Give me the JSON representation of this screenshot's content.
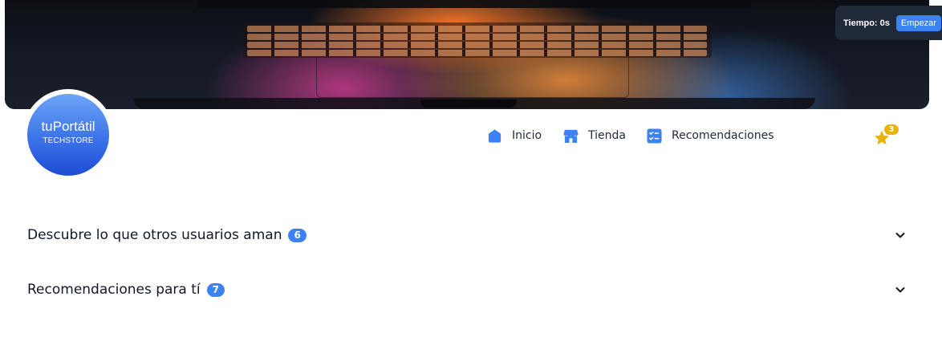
{
  "timer": {
    "label": "Tiempo: 0s",
    "start_label": "Empezar"
  },
  "brand": {
    "name": "tuPortátil",
    "tagline": "TECHSTORE"
  },
  "nav": {
    "items": [
      {
        "label": "Inicio",
        "icon": "home-icon"
      },
      {
        "label": "Tienda",
        "icon": "store-icon"
      },
      {
        "label": "Recomendaciones",
        "icon": "checklist-icon"
      }
    ]
  },
  "favorites": {
    "icon": "star-icon",
    "count": "3"
  },
  "sections": [
    {
      "title": "Descubre lo que otros usuarios aman",
      "count": "6",
      "icon": "chevron-down-icon"
    },
    {
      "title": "Recomendaciones para tí",
      "count": "7",
      "icon": "chevron-down-icon"
    }
  ],
  "colors": {
    "accent": "#3b82f6",
    "badge_yellow": "#eab308",
    "timer_bg": "#1f2937",
    "stop_red": "#ef4444"
  }
}
